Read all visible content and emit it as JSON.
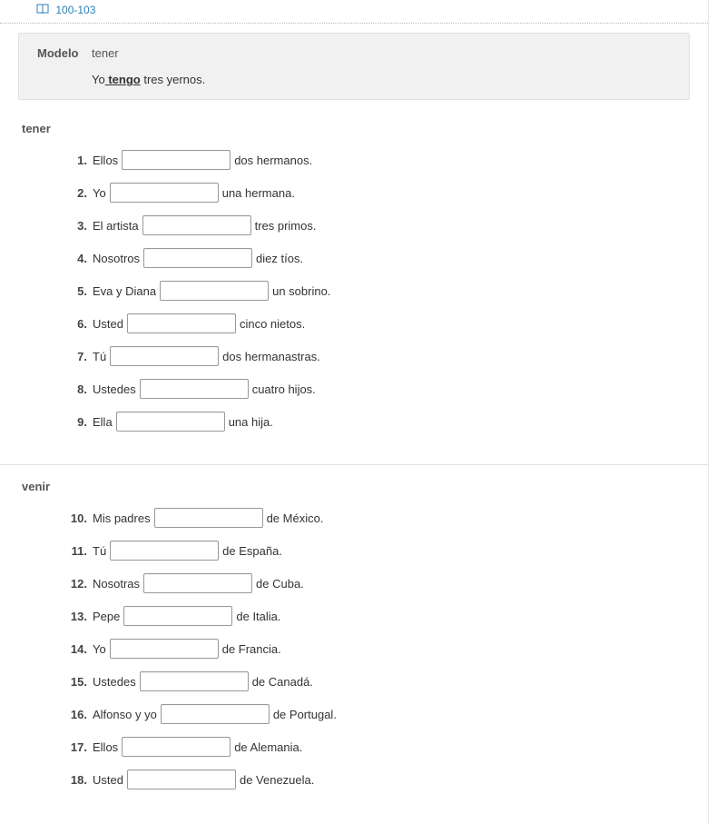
{
  "ref": {
    "label": "100-103"
  },
  "modelo": {
    "label": "Modelo",
    "verb": "tener",
    "sentence_before": "Yo",
    "answer": " tengo",
    "sentence_after": " tres yernos."
  },
  "sections": [
    {
      "title": "tener",
      "items": [
        {
          "num": "1.",
          "before": "Ellos",
          "after": "dos hermanos."
        },
        {
          "num": "2.",
          "before": "Yo",
          "after": "una hermana."
        },
        {
          "num": "3.",
          "before": "El artista",
          "after": "tres primos."
        },
        {
          "num": "4.",
          "before": "Nosotros",
          "after": "diez tíos."
        },
        {
          "num": "5.",
          "before": "Eva y Diana",
          "after": "un sobrino."
        },
        {
          "num": "6.",
          "before": "Usted",
          "after": "cinco nietos."
        },
        {
          "num": "7.",
          "before": "Tú",
          "after": "dos hermanastras."
        },
        {
          "num": "8.",
          "before": "Ustedes",
          "after": "cuatro hijos."
        },
        {
          "num": "9.",
          "before": "Ella",
          "after": "una hija."
        }
      ]
    },
    {
      "title": "venir",
      "items": [
        {
          "num": "10.",
          "before": "Mis padres",
          "after": "de México."
        },
        {
          "num": "11.",
          "before": "Tú",
          "after": "de España."
        },
        {
          "num": "12.",
          "before": "Nosotras",
          "after": "de Cuba."
        },
        {
          "num": "13.",
          "before": "Pepe",
          "after": "de Italia."
        },
        {
          "num": "14.",
          "before": "Yo",
          "after": "de Francia."
        },
        {
          "num": "15.",
          "before": "Ustedes",
          "after": "de Canadá."
        },
        {
          "num": "16.",
          "before": "Alfonso y yo",
          "after": "de Portugal."
        },
        {
          "num": "17.",
          "before": "Ellos",
          "after": "de Alemania."
        },
        {
          "num": "18.",
          "before": "Usted",
          "after": "de Venezuela."
        }
      ]
    }
  ]
}
